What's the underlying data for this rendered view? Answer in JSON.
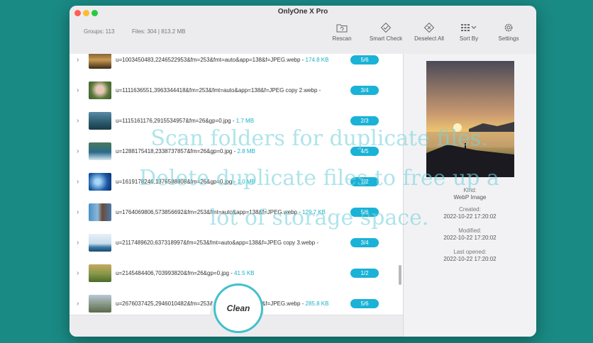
{
  "window": {
    "title": "OnlyOne X Pro"
  },
  "stats": {
    "groups": "Groups: 113",
    "files": "Files: 304 | 813.2 MB"
  },
  "toolbar": {
    "rescan": "Rescan",
    "smart_check": "Smart Check",
    "deselect_all": "Deselect All",
    "sort_by": "Sort By",
    "settings": "Settings"
  },
  "rows": [
    {
      "name": "u=1003450483,2246522953&fm=253&fmt=auto&app=138&f=JPEG.webp - ",
      "size": "174.8 KB",
      "badge": "5/6"
    },
    {
      "name": "u=1111636551,3963344418&fm=253&fmt=auto&app=138&f=JPEG copy 2.webp - ",
      "size": "",
      "badge": "3/4"
    },
    {
      "name": "u=1115161176,2915534957&fm=26&gp=0.jpg - ",
      "size": "1.7 MB",
      "badge": "2/3"
    },
    {
      "name": "u=1288175418,2338737857&fm=26&gp=0.jpg - ",
      "size": "2.8 MB",
      "badge": "4/5"
    },
    {
      "name": "u=1619178246,1376588808&fm=26&gp=0.jpg - ",
      "size": "1.0 MB",
      "badge": "1/2"
    },
    {
      "name": "u=1764069806,573856692&fm=253&fmt=auto&app=138&f=JPEG.webp - ",
      "size": "129.7 KB",
      "badge": "5/6"
    },
    {
      "name": "u=2117489620,637318997&fm=253&fmt=auto&app=138&f=JPEG copy 3.webp - ",
      "size": "",
      "badge": "3/4"
    },
    {
      "name": "u=2145484406,703993820&fm=26&gp=0.jpg - ",
      "size": "41.5 KB",
      "badge": "1/2"
    },
    {
      "name": "u=2676037425,2946010482&fm=253&fmt=auto&app=138&f=JPEG.webp - ",
      "size": "285.8 KB",
      "badge": "5/6"
    }
  ],
  "clean_button": "Clean",
  "details": {
    "kind_label": "Kind:",
    "kind_value": "WebP Image",
    "created_label": "Created:",
    "created_value": "2022-10-22 17:20:02",
    "modified_label": "Modified:",
    "modified_value": "2022-10-22 17:20:02",
    "opened_label": "Last opened:",
    "opened_value": "2022-10-22 17:20:02"
  },
  "overlay": {
    "line1": "Scan folders for duplicate files.",
    "line2": "Delete duplicate files to free up a",
    "line3": "lot of storage space."
  },
  "colors": {
    "accent": "#1ab2d6",
    "background": "#1a8a84",
    "clean_ring": "#43c0cc"
  }
}
